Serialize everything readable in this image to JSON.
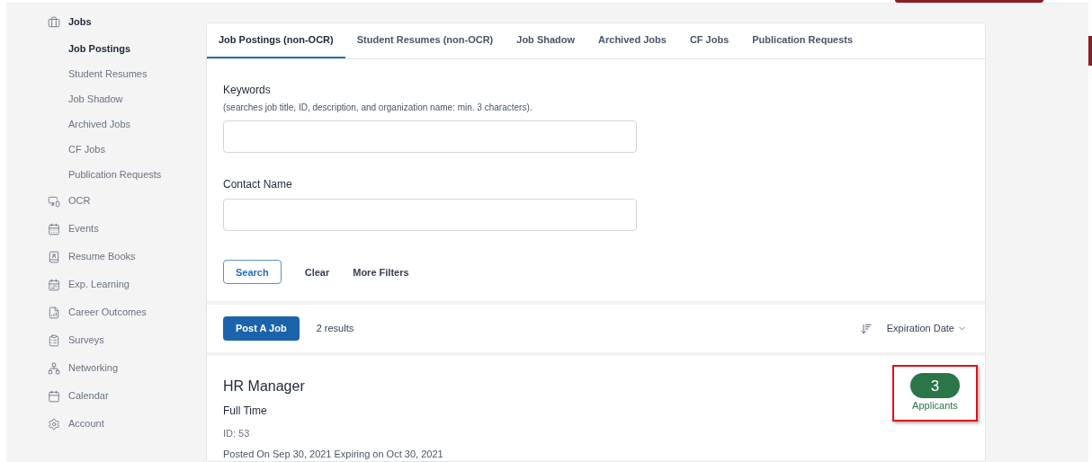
{
  "sidebar": {
    "items": [
      {
        "label": "Jobs",
        "selected": false,
        "children": [
          {
            "label": "Job Postings",
            "selected": true
          },
          {
            "label": "Student Resumes",
            "selected": false
          },
          {
            "label": "Job Shadow",
            "selected": false
          },
          {
            "label": "Archived Jobs",
            "selected": false
          },
          {
            "label": "CF Jobs",
            "selected": false
          },
          {
            "label": "Publication Requests",
            "selected": false
          }
        ]
      },
      {
        "label": "OCR",
        "selected": false
      },
      {
        "label": "Events",
        "selected": false
      },
      {
        "label": "Resume Books",
        "selected": false
      },
      {
        "label": "Exp. Learning",
        "selected": false
      },
      {
        "label": "Career Outcomes",
        "selected": false
      },
      {
        "label": "Surveys",
        "selected": false
      },
      {
        "label": "Networking",
        "selected": false
      },
      {
        "label": "Calendar",
        "selected": false
      },
      {
        "label": "Account",
        "selected": false
      }
    ]
  },
  "tabs": [
    {
      "label": "Job Postings (non-OCR)",
      "selected": true
    },
    {
      "label": "Student Resumes (non-OCR)",
      "selected": false
    },
    {
      "label": "Job Shadow",
      "selected": false
    },
    {
      "label": "Archived Jobs",
      "selected": false
    },
    {
      "label": "CF Jobs",
      "selected": false
    },
    {
      "label": "Publication Requests",
      "selected": false
    }
  ],
  "filters": {
    "keywords": {
      "label": "Keywords",
      "hint": "(searches job title, ID, description, and organization name: min. 3 characters)."
    },
    "contact_name": {
      "label": "Contact Name"
    },
    "buttons": [
      {
        "label": "Search",
        "kind": "outline"
      },
      {
        "label": "Clear",
        "kind": "text"
      },
      {
        "label": "More Filters",
        "kind": "text"
      }
    ]
  },
  "results": {
    "post_button": "Post A Job",
    "count": "2 results",
    "sort": "Expiration Date"
  },
  "jobs": [
    {
      "title": "HR Manager",
      "type": "Full Time",
      "id": "ID: 53",
      "dates": "Posted On Sep 30, 2021 Expiring on Oct 30, 2021",
      "applicants_count": "3",
      "applicants_label": "Applicants",
      "highlighted": true
    }
  ]
}
